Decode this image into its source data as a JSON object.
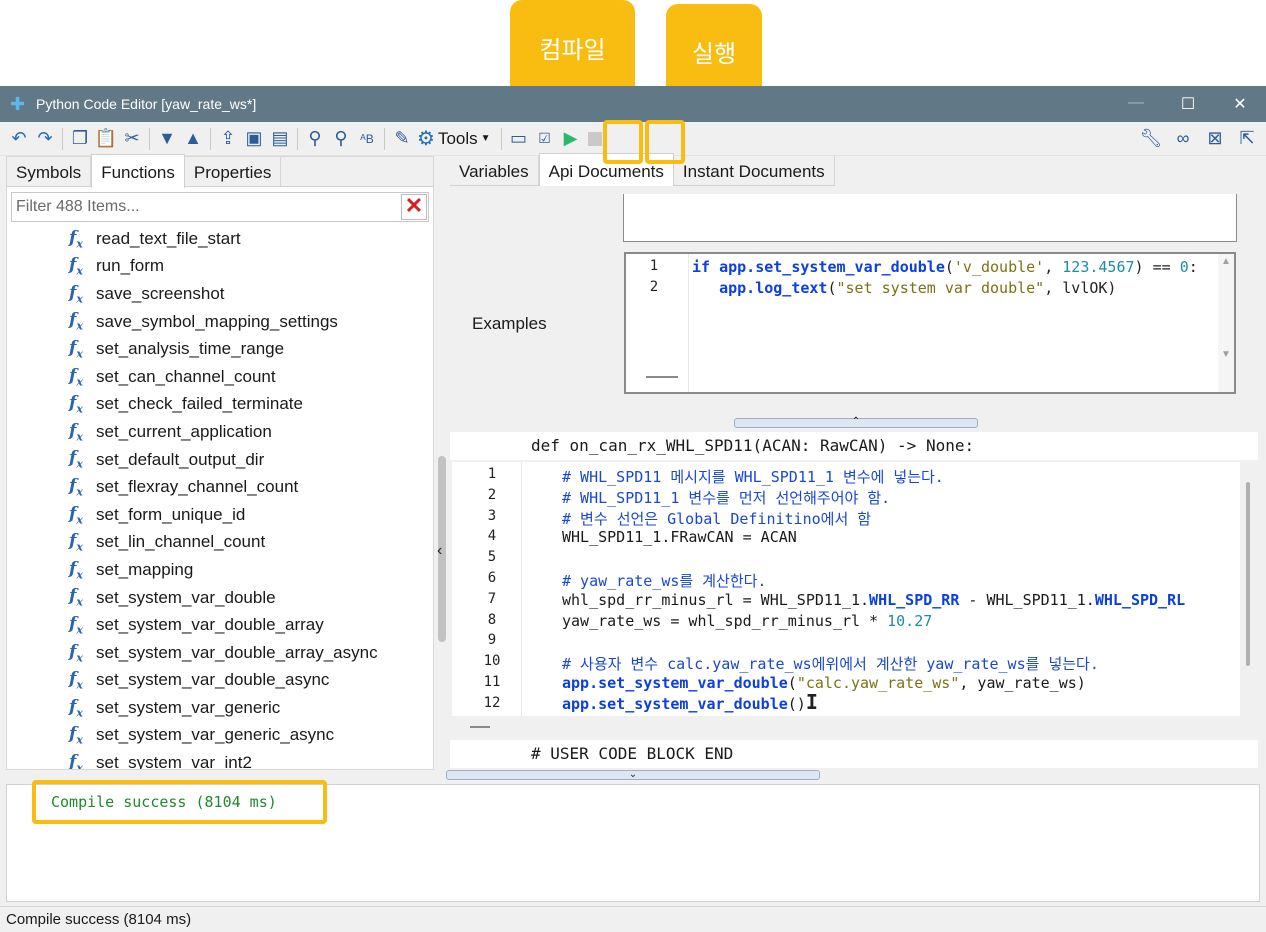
{
  "callouts": {
    "compile": "컴파일",
    "run": "실행"
  },
  "window": {
    "title": "Python Code Editor [yaw_rate_ws*]",
    "minimize": "—",
    "maximize": "☐",
    "close": "✕"
  },
  "toolbar": {
    "tools_label": "Tools"
  },
  "left_tabs": [
    "Symbols",
    "Functions",
    "Properties"
  ],
  "filter": {
    "placeholder": "Filter 488 Items..."
  },
  "functions": [
    "read_text_file_start",
    "run_form",
    "save_screenshot",
    "save_symbol_mapping_settings",
    "set_analysis_time_range",
    "set_can_channel_count",
    "set_check_failed_terminate",
    "set_current_application",
    "set_default_output_dir",
    "set_flexray_channel_count",
    "set_form_unique_id",
    "set_lin_channel_count",
    "set_mapping",
    "set_system_var_double",
    "set_system_var_double_array",
    "set_system_var_double_array_async",
    "set_system_var_double_async",
    "set_system_var_generic",
    "set_system_var_generic_async",
    "set_system_var_int2"
  ],
  "right_tabs": [
    "Variables",
    "Api Documents",
    "Instant Documents"
  ],
  "api_doc": {
    "examples_label": "Examples",
    "example_lines": [
      {
        "n": "1",
        "kw": "if",
        "a": " app.",
        "fn": "set_system_var_double",
        "b": "(",
        "s": "'v_double'",
        "c": ", ",
        "num": "123.4567",
        "d": ") == ",
        "num2": "0",
        "e": ":"
      },
      {
        "n": "2",
        "pad": "   ",
        "obj": "app.",
        "fn": "log_text",
        "b": "(",
        "s": "\"set system var double\"",
        "c": ", lvlOK)"
      }
    ]
  },
  "editor": {
    "signature": "def on_can_rx_WHL_SPD11(ACAN: RawCAN) -> None:",
    "footer": "# USER CODE BLOCK END",
    "lines": [
      {
        "n": "1",
        "t": "# WHL_SPD11 메시지를 WHL_SPD11_1 변수에 넣는다."
      },
      {
        "n": "2",
        "t": "# WHL_SPD11_1 변수를 먼저 선언해주어야 함."
      },
      {
        "n": "3",
        "t": "# 변수 선언은 Global Definitino에서 함"
      },
      {
        "n": "4",
        "t": "WHL_SPD11_1.FRawCAN = ACAN"
      },
      {
        "n": "5",
        "t": ""
      },
      {
        "n": "6",
        "t": "# yaw_rate_ws를 계산한다."
      },
      {
        "n": "7",
        "t": "whl_spd_rr_minus_rl = WHL_SPD11_1.WHL_SPD_RR - WHL_SPD11_1.WHL_SPD_RL"
      },
      {
        "n": "8",
        "t": "yaw_rate_ws = whl_spd_rr_minus_rl * 10.27"
      },
      {
        "n": "9",
        "t": ""
      },
      {
        "n": "10",
        "t": "# 사용자 변수 calc.yaw_rate_ws에위에서 계산한 yaw_rate_ws를 넣는다."
      },
      {
        "n": "11",
        "t": "app.set_system_var_double(\"calc.yaw_rate_ws\", yaw_rate_ws)"
      },
      {
        "n": "12",
        "t": "app.set_system_var_double()"
      }
    ]
  },
  "output": {
    "message": "Compile success (8104 ms)"
  },
  "status": {
    "text": "Compile success (8104 ms)"
  },
  "colors": {
    "titlebar": "#617886",
    "callout": "#f9bd12",
    "keyword": "#0b3fe0",
    "comment": "#1947d6",
    "success": "#1f8a2a"
  }
}
